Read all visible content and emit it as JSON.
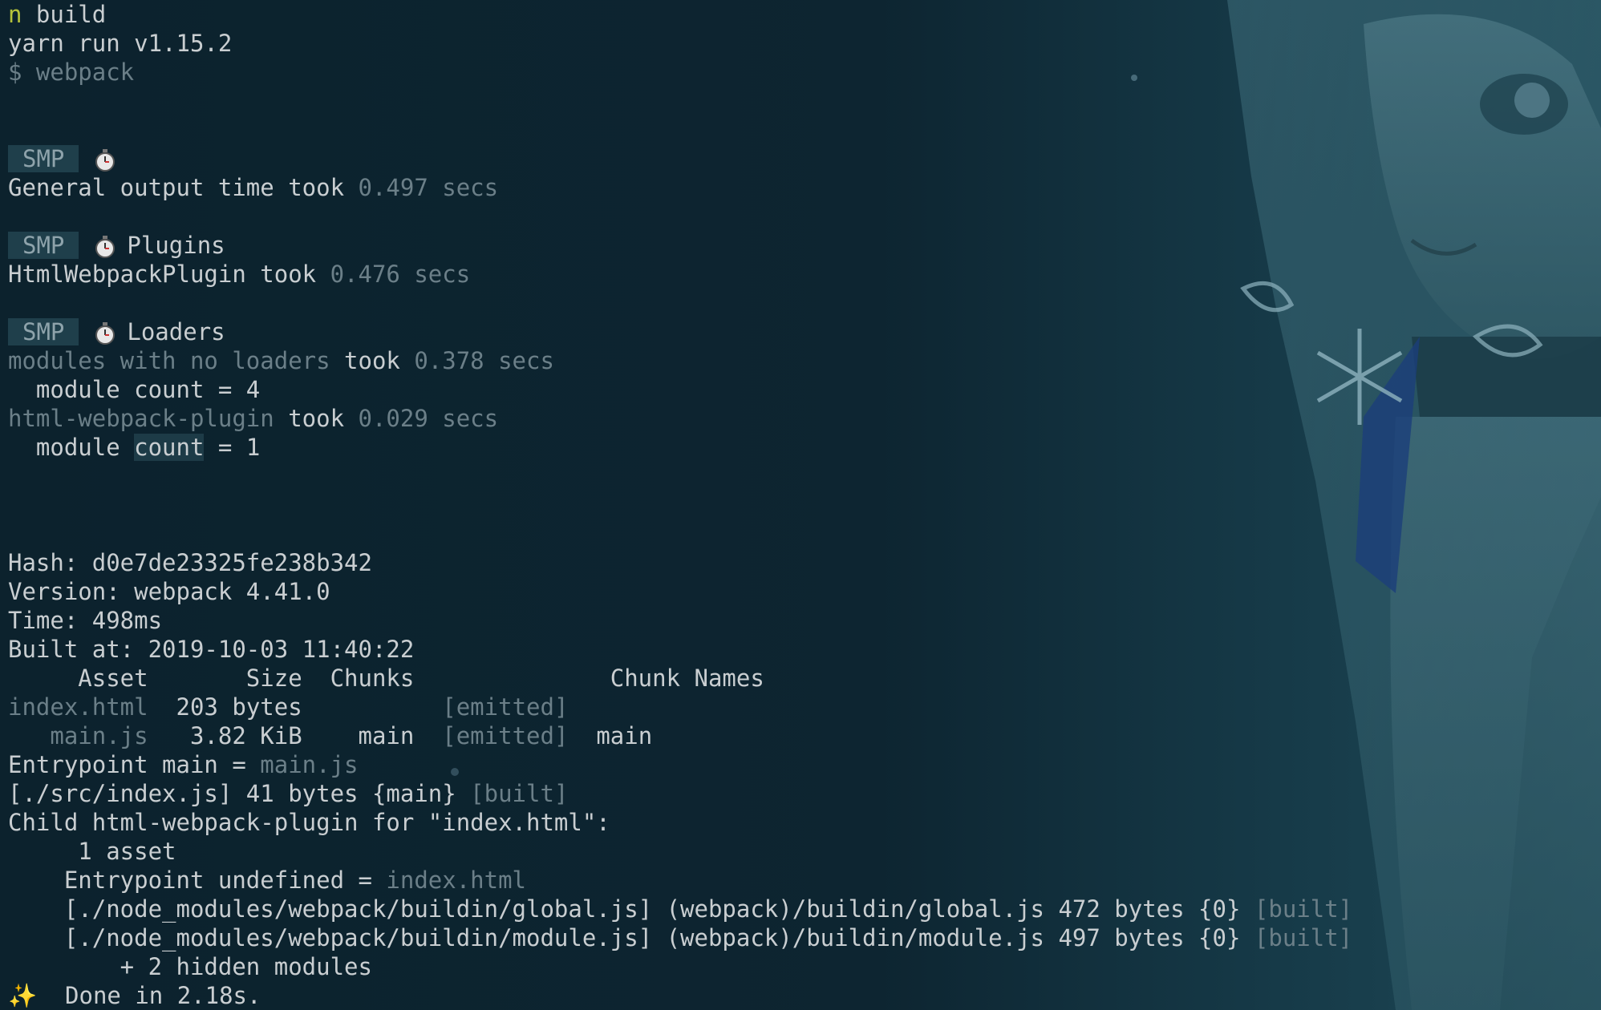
{
  "colors": {
    "background": "#0d2430",
    "text": "#c9ced1",
    "dim_text": "#6b7f88",
    "badge_bg": "#1f3f4b",
    "prompt_accent": "#b5c23a",
    "sparkles": "#f2d56b"
  },
  "terminal": {
    "line1_prefix": "n",
    "line1_text": " build",
    "line2": "yarn run v1.15.2",
    "line3": "$ webpack",
    "smp_badge": "SMP",
    "stopwatch_icon": "stopwatch-icon",
    "general_label": "General output time took ",
    "general_value": "0.497 secs",
    "plugins_title": "Plugins",
    "plugin_name": "HtmlWebpackPlugin took ",
    "plugin_value": "0.476 secs",
    "loaders_title": "Loaders",
    "loader1_name": "modules with no loaders",
    "loader1_took": " took ",
    "loader1_value": "0.378 secs",
    "loader1_count": "  module count = 4",
    "loader2_name": "html-webpack-plugin",
    "loader2_took": " took ",
    "loader2_value": "0.029 secs",
    "loader2_count_prefix": "  module ",
    "loader2_count_word": "count",
    "loader2_count_suffix": " = 1",
    "hash": "Hash: d0e7de23325fe238b342",
    "version": "Version: webpack 4.41.0",
    "time": "Time: 498ms",
    "built_at": "Built at: 2019-10-03 11:40:22",
    "table_header": "     Asset       Size  Chunks              Chunk Names",
    "row1_asset": "index.html",
    "row1_rest": "  203 bytes          ",
    "row1_status": "[emitted]",
    "row2_asset": "   main.js",
    "row2_rest": "   3.82 KiB    main  ",
    "row2_status": "[emitted]",
    "row2_names": "  main",
    "entrypoint_prefix": "Entrypoint main = ",
    "entrypoint_file": "main.js",
    "src_line_prefix": "[./src/index.js] 41 bytes {main} ",
    "src_line_status": "[built]",
    "child_line": "Child html-webpack-plugin for \"index.html\":",
    "child_asset": "     1 asset",
    "child_entry_prefix": "    Entrypoint undefined = ",
    "child_entry_file": "index.html",
    "global_line": "    [./node_modules/webpack/buildin/global.js] (webpack)/buildin/global.js 472 bytes {0} ",
    "global_status": "[built]",
    "module_line": "    [./node_modules/webpack/buildin/module.js] (webpack)/buildin/module.js 497 bytes {0} ",
    "module_status": "[built]",
    "hidden_modules": "        + 2 hidden modules",
    "sparkles_icon": "✨",
    "done_line": "  Done in 2.18s."
  }
}
